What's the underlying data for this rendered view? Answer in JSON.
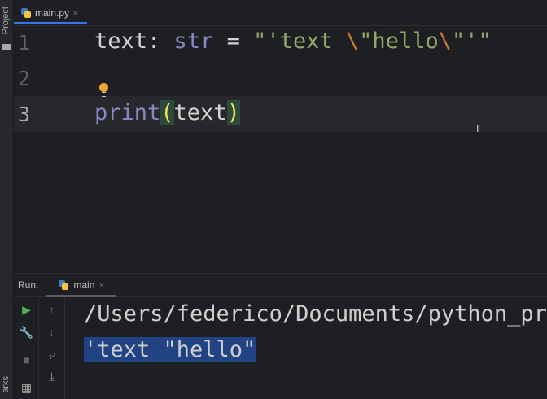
{
  "sidebar": {
    "project_label": "Project",
    "bookmarks_label": "arks"
  },
  "editor_tab": {
    "filename": "main.py",
    "close": "×"
  },
  "code": {
    "line_numbers": [
      "1",
      "2",
      "3"
    ],
    "line1": {
      "var": "text: ",
      "type": "str",
      "eq": " = ",
      "s1": "\"'text ",
      "e1": "\\",
      "s2": "\"hello",
      "e2": "\\",
      "s3": "\"'\""
    },
    "line3": {
      "fn": "print",
      "open": "(",
      "arg": "text",
      "close": ")"
    }
  },
  "run": {
    "label": "Run:",
    "config": "main",
    "close": "×"
  },
  "console": {
    "line1": "/Users/federico/Documents/python_pr",
    "line2": "'text \"hello\""
  },
  "colors": {
    "accent": "#3574f0",
    "selection": "#214283",
    "string": "#8fa86a",
    "escape": "#cc7832",
    "keyword": "#8888c6"
  }
}
